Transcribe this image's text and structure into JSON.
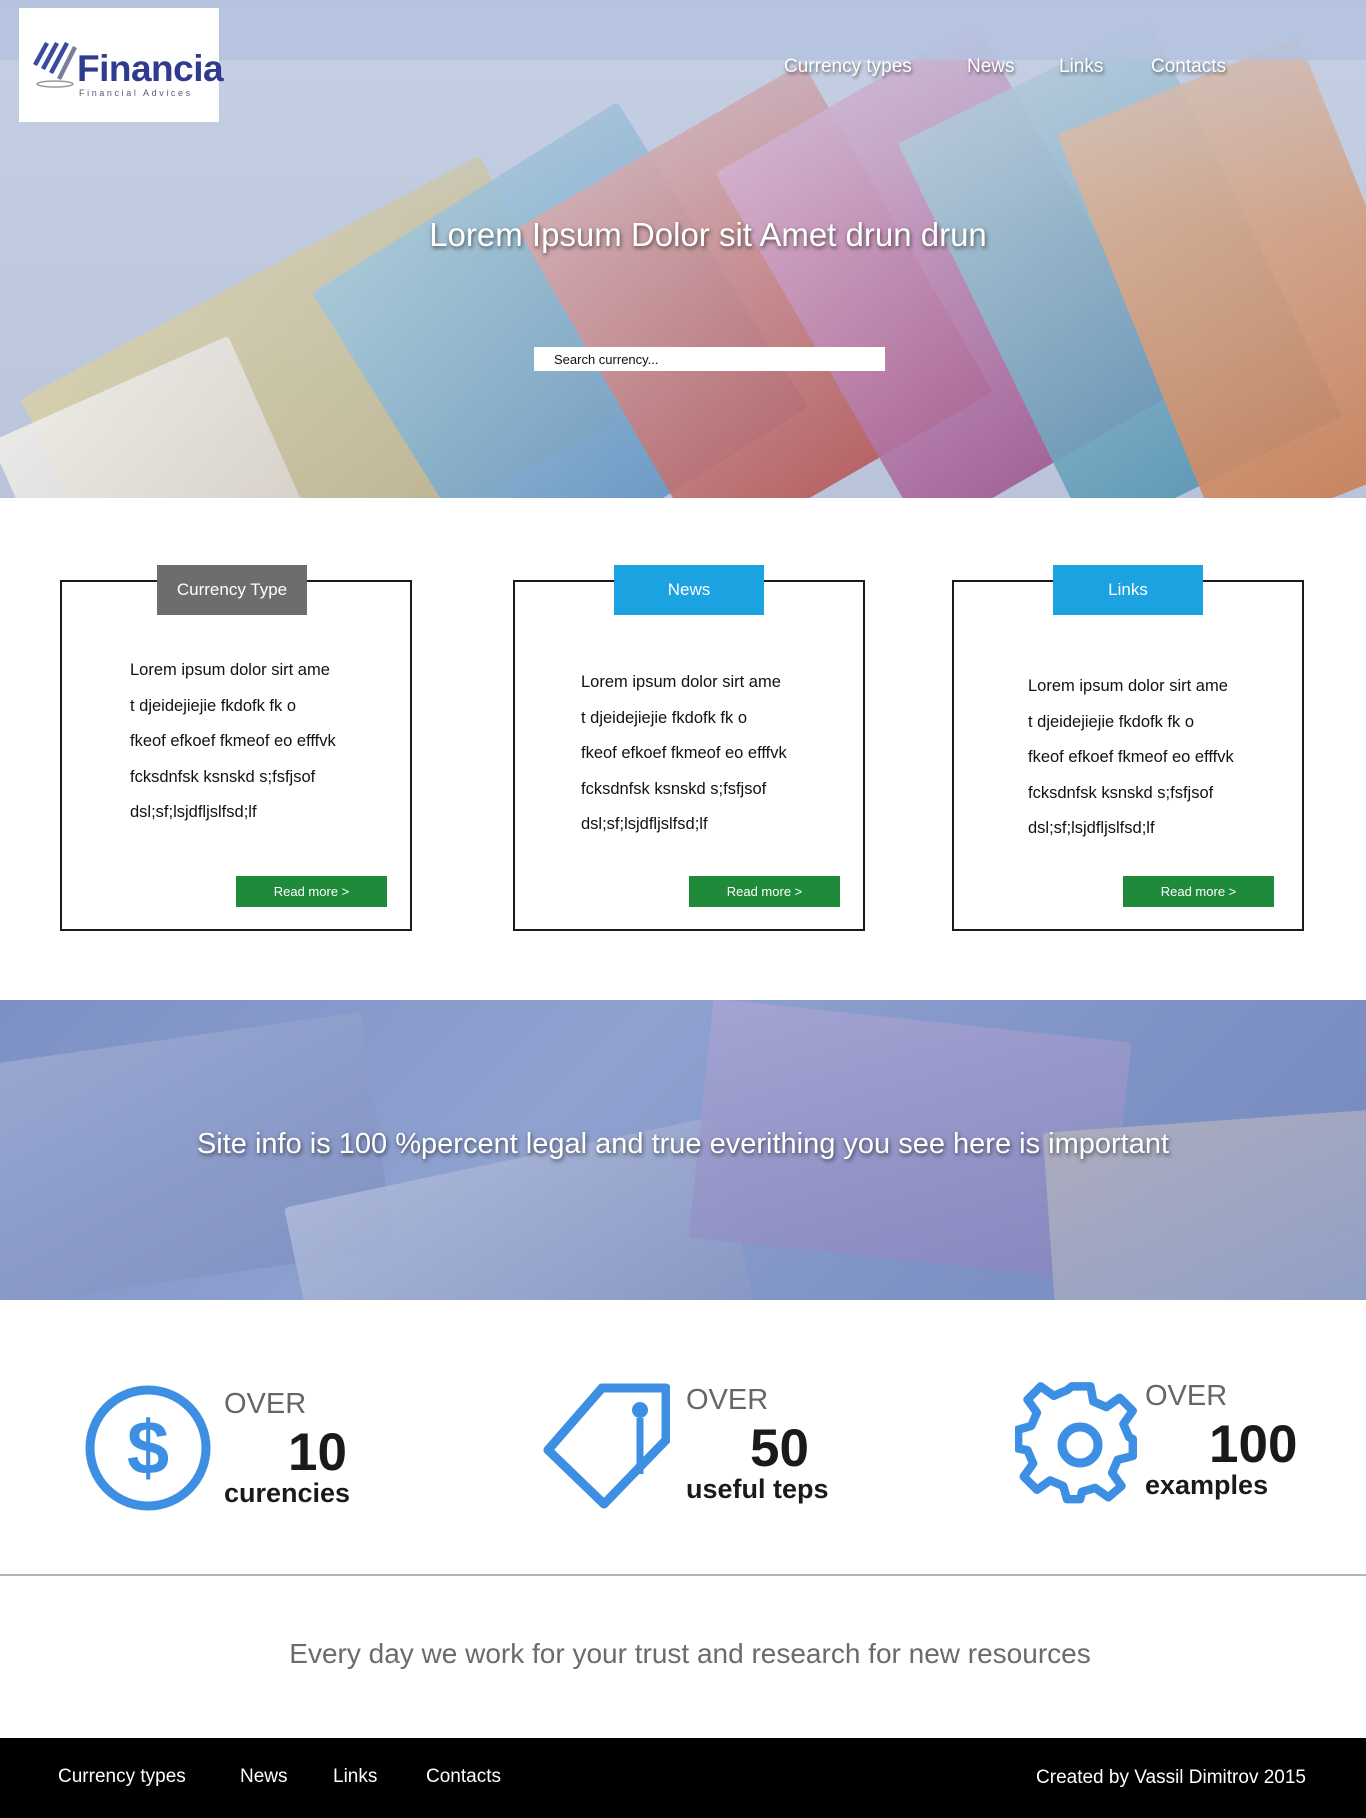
{
  "logo": {
    "name": "Financia",
    "tagline": "Financial Advices"
  },
  "nav": [
    {
      "label": "Currency types"
    },
    {
      "label": "News"
    },
    {
      "label": "Links"
    },
    {
      "label": "Contacts"
    }
  ],
  "hero": {
    "title": "Lorem Ipsum Dolor sit  Amet drun drun",
    "search_placeholder": "Search currency..."
  },
  "cards": [
    {
      "tab": "Currency Type",
      "tab_color": "#6d6d6d",
      "text": "Lorem ipsum  dolor sirt ame\nt djeidejiejie fkdofk fk o\nfkeof efkoef  fkmeof eo efffvk\nfcksdnfsk ksnskd   s;fsfjsof\ndsl;sf;lsjdfljslfsd;lf",
      "button": "Read more   >"
    },
    {
      "tab": "News",
      "tab_color": "#1aa3e0",
      "text": "Lorem ipsum  dolor sirt ame\nt djeidejiejie fkdofk fk o\nfkeof efkoef  fkmeof eo efffvk\nfcksdnfsk ksnskd   s;fsfjsof\ndsl;sf;lsjdfljslfsd;lf",
      "button": "Read more   >"
    },
    {
      "tab": "Links",
      "tab_color": "#1aa3e0",
      "text": "Lorem ipsum  dolor sirt ame\nt djeidejiejie fkdofk fk o\nfkeof efkoef  fkmeof eo efffvk\nfcksdnfsk ksnskd   s;fsfjsof\ndsl;sf;lsjdfljslfsd;lf",
      "button": "Read more   >"
    }
  ],
  "banner": {
    "text": "Site info is 100 %percent legal and true everithing you see here is important"
  },
  "stats": [
    {
      "icon": "dollar-icon",
      "over": "OVER",
      "number": "10",
      "label": "curencies"
    },
    {
      "icon": "tag-icon",
      "over": "OVER",
      "number": "50",
      "label": "useful teps"
    },
    {
      "icon": "gear-icon",
      "over": "OVER",
      "number": "100",
      "label": "examples"
    }
  ],
  "tagline": "Every day we work for your trust and research for new resources",
  "footer": {
    "nav": [
      {
        "label": "Currency types"
      },
      {
        "label": "News"
      },
      {
        "label": "Links"
      },
      {
        "label": "Contacts"
      }
    ],
    "credit": "Created by Vassil Dimitrov 2015"
  },
  "colors": {
    "accent": "#3d8fe3",
    "button_green": "#1f8a3a",
    "tab_blue": "#1aa3e0",
    "tab_gray": "#6d6d6d"
  }
}
